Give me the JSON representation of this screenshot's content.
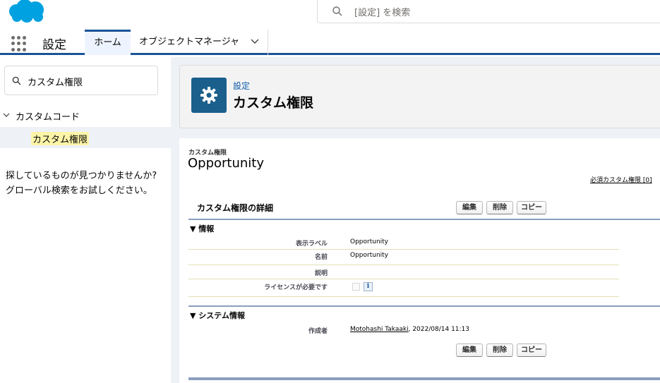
{
  "header": {
    "search_placeholder": "[設定] を検索",
    "brand_color": "#00a1e0"
  },
  "nav": {
    "app_name": "設定",
    "tabs": [
      {
        "label": "ホーム"
      },
      {
        "label": "オブジェクトマネージャ"
      }
    ]
  },
  "sidebar": {
    "search_value": "カスタム権限",
    "tree_parent": "カスタムコード",
    "tree_child": "カスタム権限",
    "help_line1": "探しているものが見つかりませんか?",
    "help_line2": "グローバル検索をお試しください。"
  },
  "page_header": {
    "subtitle": "設定",
    "title": "カスタム権限",
    "icon": "gear-icon"
  },
  "detail": {
    "record_type": "カスタム権限",
    "record_name": "Opportunity",
    "required_link": "必須カスタム権限 [0]",
    "section_title": "カスタム権限の詳細",
    "buttons": {
      "edit": "編集",
      "delete": "削除",
      "copy": "コピー"
    },
    "info_heading": "▼ 情報",
    "fields": [
      {
        "label": "表示ラベル",
        "value": "Opportunity"
      },
      {
        "label": "名前",
        "value": "Opportunity"
      },
      {
        "label": "説明",
        "value": ""
      },
      {
        "label": "ライセンスが必要です",
        "value": ""
      }
    ],
    "license_required": false,
    "system_heading": "▼ システム情報",
    "created_by_label": "作成者",
    "created_by_name": "Motohashi Takaaki",
    "created_by_date": ", 2022/08/14 11:13"
  }
}
